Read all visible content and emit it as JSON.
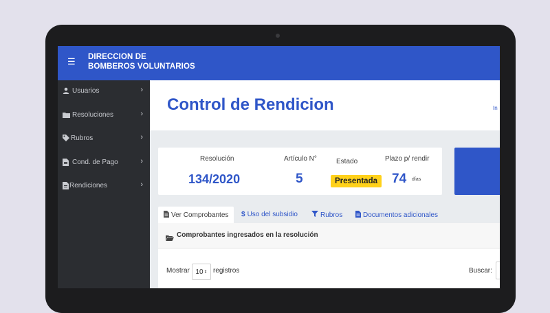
{
  "app": {
    "brand_line1": "DIRECCION DE",
    "brand_line2": "BOMBEROS VOLUNTARIOS",
    "menu_icon": "hamburger-icon",
    "accent_color": "#2f56c8"
  },
  "sidebar": {
    "items": [
      {
        "label": "Usuarios",
        "icon": "user-icon"
      },
      {
        "label": "Resoluciones",
        "icon": "folder-icon"
      },
      {
        "label": "Rubros",
        "icon": "tag-icon"
      },
      {
        "label": "Cond. de Pago",
        "icon": "file-icon"
      },
      {
        "label": "Rendiciones",
        "icon": "file-icon"
      }
    ]
  },
  "page": {
    "title": "Control de Rendicion",
    "header_link": "In"
  },
  "summary": {
    "resolucion_label": "Resolución",
    "resolucion_value": "134/2020",
    "articulo_label": "Artículo N°",
    "articulo_value": "5",
    "estado_label": "Estado",
    "estado_value": "Presentada",
    "estado_color": "#ffd11a",
    "plazo_label": "Plazo p/ rendir",
    "plazo_value": "74",
    "plazo_unit": "días"
  },
  "tabs": [
    {
      "label": "Ver Comprobantes",
      "icon": "file-icon"
    },
    {
      "label": "Uso del subsidio",
      "icon": "dollar-icon"
    },
    {
      "label": "Rubros",
      "icon": "filter-icon"
    },
    {
      "label": "Documentos adicionales",
      "icon": "document-icon"
    }
  ],
  "panel": {
    "title": "Comprobantes ingresados en la resolución",
    "show_label": "Mostrar",
    "show_value": "10",
    "records_label": "registros",
    "search_label": "Buscar:"
  }
}
